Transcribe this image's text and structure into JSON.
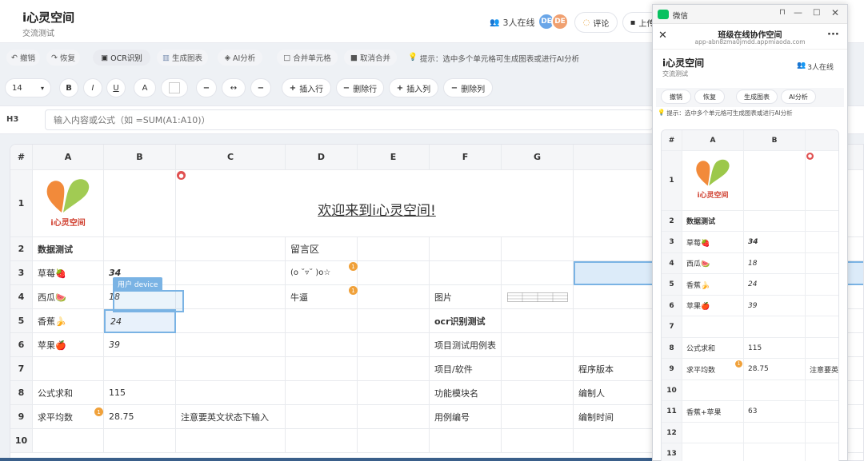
{
  "app": {
    "title": "i心灵空间",
    "subtitle": "交流测试",
    "online": "3人在线",
    "avatars": [
      "DE",
      "DE"
    ],
    "comment": "评论",
    "upload": "上传"
  },
  "toolbar1": {
    "undo": "撤销",
    "redo": "恢复",
    "ocr": "OCR识别",
    "chart": "生成图表",
    "ai": "AI分析",
    "merge": "合并单元格",
    "unmerge": "取消合并",
    "tip": "提示：选中多个单元格可生成图表或进行AI分析"
  },
  "toolbar2": {
    "font_size": "14",
    "bold": "B",
    "italic": "I",
    "underline": "U",
    "font_color": "A",
    "minus1": "−",
    "arrows": "↔",
    "minus2": "−",
    "insert_row": "插入行",
    "delete_row": "删除行",
    "insert_col": "插入列",
    "delete_col": "删除列"
  },
  "formula": {
    "cell_ref": "H3",
    "placeholder": "输入内容或公式（如 =SUM(A1:A10)）"
  },
  "grid": {
    "corner": "#",
    "cols": [
      "A",
      "B",
      "C",
      "D",
      "E",
      "F",
      "G"
    ],
    "rows": [
      "1",
      "2",
      "3",
      "4",
      "5",
      "6",
      "7",
      "8",
      "9",
      "10"
    ],
    "banner": "欢迎来到i心灵空间!",
    "logo_text": "i心灵空间",
    "cells": {
      "A2": "数据测试",
      "D2": "留言区",
      "A3": "草莓🍓",
      "B3": "34",
      "D3": "(o ˘▿˘ )o☆",
      "A4": "西瓜🍉",
      "B4": "18",
      "D4": "牛逼",
      "F4": "图片",
      "A5": "香蕉🍌",
      "B5": "24",
      "F5": "ocr识别测试",
      "A6": "苹果🍎",
      "B6": "39",
      "F6": "项目测试用例表",
      "F7": "项目/软件",
      "H7": "程序版本",
      "A8": "公式求和",
      "B8": "115",
      "F8": "功能模块名",
      "H8": "编制人",
      "A9": "求平均数",
      "B9": "28.75",
      "C9": "注意要英文状态下输入",
      "F9": "用例编号",
      "H9": "编制时间"
    },
    "cursor_label": "用户 device",
    "badges": {
      "lock": "🔒",
      "comment": "1"
    }
  },
  "wechat": {
    "app_name": "微信",
    "page_title": "班级在线协作空间",
    "url": "app-abn8zma0jmdd.appmiaoda.com",
    "title": "i心灵空间",
    "subtitle": "交流测试",
    "online": "3人在线",
    "undo": "撤销",
    "redo": "恢复",
    "chart": "生成图表",
    "ai": "AI分析",
    "tip": "提示：选中多个单元格可生成图表或进行AI分析",
    "corner": "#",
    "cols": [
      "A",
      "B"
    ],
    "rows": [
      "1",
      "2",
      "3",
      "4",
      "5",
      "6",
      "7",
      "8",
      "9",
      "10",
      "11",
      "12",
      "13"
    ],
    "cells": {
      "A2": "数据测试",
      "A3": "草莓🍓",
      "B3": "34",
      "A4": "西瓜🍉",
      "B4": "18",
      "A5": "香蕉🍌",
      "B5": "24",
      "A6": "苹果🍎",
      "B6": "39",
      "A8": "公式求和",
      "B8": "115",
      "A9": "求平均数",
      "B9": "28.75",
      "C9": "注意要英",
      "A11": "香蕉+苹果",
      "B11": "63"
    }
  },
  "colors": {
    "accent": "#5ea8e0",
    "avatar1": "#6aa6e8",
    "avatar2": "#f0a070",
    "comment_dot": "#f0a13a",
    "lock": "#e05050",
    "wechat_green": "#07c160"
  }
}
